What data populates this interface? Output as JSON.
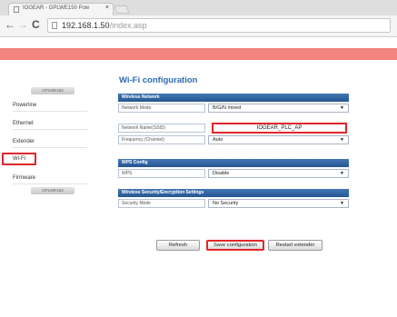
{
  "browser": {
    "tab_title": "IOGEAR - GPLWE150 Pow",
    "tab_close": "×",
    "back": "←",
    "forward": "→",
    "reload": "C",
    "url_host": "192.168.1.50",
    "url_path": "/index.asp"
  },
  "sidebar": {
    "top_header": "GPLWE150",
    "items": [
      {
        "label": "Powerline"
      },
      {
        "label": "Ethernet"
      },
      {
        "label": "Extender"
      },
      {
        "label": "Wi-Fi"
      },
      {
        "label": "Firmware"
      }
    ],
    "bottom_header": "GPLWE150",
    "active_item": "Wi-Fi"
  },
  "main": {
    "title": "Wi-Fi configuration",
    "wireless_network": {
      "header": "Wireless Network",
      "network_mode_label": "Network Mode",
      "network_mode_value": "B/G/N mixed",
      "ssid_label": "Network Name(SSID)",
      "ssid_value": "IOGEAR_PLC_AP",
      "frequency_label": "Frequency (Channel)",
      "frequency_value": "Auto"
    },
    "wps": {
      "header": "WPS Config",
      "wps_label": "WPS",
      "wps_value": "Disable"
    },
    "security": {
      "header": "Wireless Security/Encryption Settings",
      "mode_label": "Security Mode",
      "mode_value": "No Security"
    },
    "buttons": {
      "refresh": "Refresh",
      "save": "Save configuration",
      "restart": "Restart extender"
    },
    "dropdown_arrow": "▼"
  },
  "colors": {
    "banner": "#f2857e",
    "section_header": "#2d5f9c",
    "highlight": "#e0262a",
    "title": "#2d6bb0"
  }
}
